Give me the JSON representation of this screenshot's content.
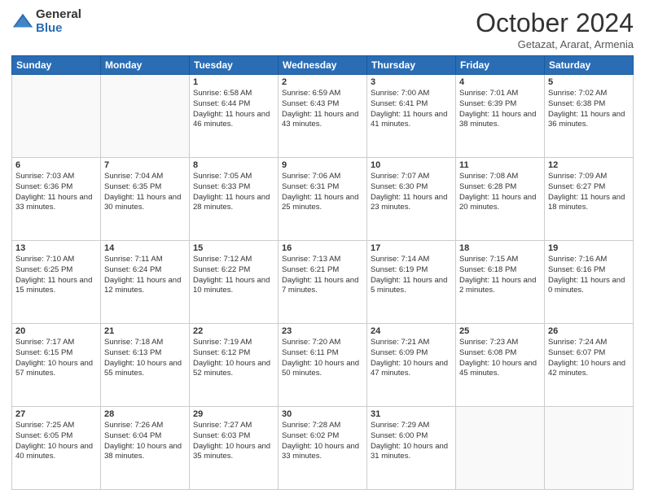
{
  "logo": {
    "general": "General",
    "blue": "Blue"
  },
  "header": {
    "month": "October 2024",
    "location": "Getazat, Ararat, Armenia"
  },
  "days_of_week": [
    "Sunday",
    "Monday",
    "Tuesday",
    "Wednesday",
    "Thursday",
    "Friday",
    "Saturday"
  ],
  "weeks": [
    [
      {
        "day": "",
        "info": ""
      },
      {
        "day": "",
        "info": ""
      },
      {
        "day": "1",
        "info": "Sunrise: 6:58 AM\nSunset: 6:44 PM\nDaylight: 11 hours and 46 minutes."
      },
      {
        "day": "2",
        "info": "Sunrise: 6:59 AM\nSunset: 6:43 PM\nDaylight: 11 hours and 43 minutes."
      },
      {
        "day": "3",
        "info": "Sunrise: 7:00 AM\nSunset: 6:41 PM\nDaylight: 11 hours and 41 minutes."
      },
      {
        "day": "4",
        "info": "Sunrise: 7:01 AM\nSunset: 6:39 PM\nDaylight: 11 hours and 38 minutes."
      },
      {
        "day": "5",
        "info": "Sunrise: 7:02 AM\nSunset: 6:38 PM\nDaylight: 11 hours and 36 minutes."
      }
    ],
    [
      {
        "day": "6",
        "info": "Sunrise: 7:03 AM\nSunset: 6:36 PM\nDaylight: 11 hours and 33 minutes."
      },
      {
        "day": "7",
        "info": "Sunrise: 7:04 AM\nSunset: 6:35 PM\nDaylight: 11 hours and 30 minutes."
      },
      {
        "day": "8",
        "info": "Sunrise: 7:05 AM\nSunset: 6:33 PM\nDaylight: 11 hours and 28 minutes."
      },
      {
        "day": "9",
        "info": "Sunrise: 7:06 AM\nSunset: 6:31 PM\nDaylight: 11 hours and 25 minutes."
      },
      {
        "day": "10",
        "info": "Sunrise: 7:07 AM\nSunset: 6:30 PM\nDaylight: 11 hours and 23 minutes."
      },
      {
        "day": "11",
        "info": "Sunrise: 7:08 AM\nSunset: 6:28 PM\nDaylight: 11 hours and 20 minutes."
      },
      {
        "day": "12",
        "info": "Sunrise: 7:09 AM\nSunset: 6:27 PM\nDaylight: 11 hours and 18 minutes."
      }
    ],
    [
      {
        "day": "13",
        "info": "Sunrise: 7:10 AM\nSunset: 6:25 PM\nDaylight: 11 hours and 15 minutes."
      },
      {
        "day": "14",
        "info": "Sunrise: 7:11 AM\nSunset: 6:24 PM\nDaylight: 11 hours and 12 minutes."
      },
      {
        "day": "15",
        "info": "Sunrise: 7:12 AM\nSunset: 6:22 PM\nDaylight: 11 hours and 10 minutes."
      },
      {
        "day": "16",
        "info": "Sunrise: 7:13 AM\nSunset: 6:21 PM\nDaylight: 11 hours and 7 minutes."
      },
      {
        "day": "17",
        "info": "Sunrise: 7:14 AM\nSunset: 6:19 PM\nDaylight: 11 hours and 5 minutes."
      },
      {
        "day": "18",
        "info": "Sunrise: 7:15 AM\nSunset: 6:18 PM\nDaylight: 11 hours and 2 minutes."
      },
      {
        "day": "19",
        "info": "Sunrise: 7:16 AM\nSunset: 6:16 PM\nDaylight: 11 hours and 0 minutes."
      }
    ],
    [
      {
        "day": "20",
        "info": "Sunrise: 7:17 AM\nSunset: 6:15 PM\nDaylight: 10 hours and 57 minutes."
      },
      {
        "day": "21",
        "info": "Sunrise: 7:18 AM\nSunset: 6:13 PM\nDaylight: 10 hours and 55 minutes."
      },
      {
        "day": "22",
        "info": "Sunrise: 7:19 AM\nSunset: 6:12 PM\nDaylight: 10 hours and 52 minutes."
      },
      {
        "day": "23",
        "info": "Sunrise: 7:20 AM\nSunset: 6:11 PM\nDaylight: 10 hours and 50 minutes."
      },
      {
        "day": "24",
        "info": "Sunrise: 7:21 AM\nSunset: 6:09 PM\nDaylight: 10 hours and 47 minutes."
      },
      {
        "day": "25",
        "info": "Sunrise: 7:23 AM\nSunset: 6:08 PM\nDaylight: 10 hours and 45 minutes."
      },
      {
        "day": "26",
        "info": "Sunrise: 7:24 AM\nSunset: 6:07 PM\nDaylight: 10 hours and 42 minutes."
      }
    ],
    [
      {
        "day": "27",
        "info": "Sunrise: 7:25 AM\nSunset: 6:05 PM\nDaylight: 10 hours and 40 minutes."
      },
      {
        "day": "28",
        "info": "Sunrise: 7:26 AM\nSunset: 6:04 PM\nDaylight: 10 hours and 38 minutes."
      },
      {
        "day": "29",
        "info": "Sunrise: 7:27 AM\nSunset: 6:03 PM\nDaylight: 10 hours and 35 minutes."
      },
      {
        "day": "30",
        "info": "Sunrise: 7:28 AM\nSunset: 6:02 PM\nDaylight: 10 hours and 33 minutes."
      },
      {
        "day": "31",
        "info": "Sunrise: 7:29 AM\nSunset: 6:00 PM\nDaylight: 10 hours and 31 minutes."
      },
      {
        "day": "",
        "info": ""
      },
      {
        "day": "",
        "info": ""
      }
    ]
  ]
}
